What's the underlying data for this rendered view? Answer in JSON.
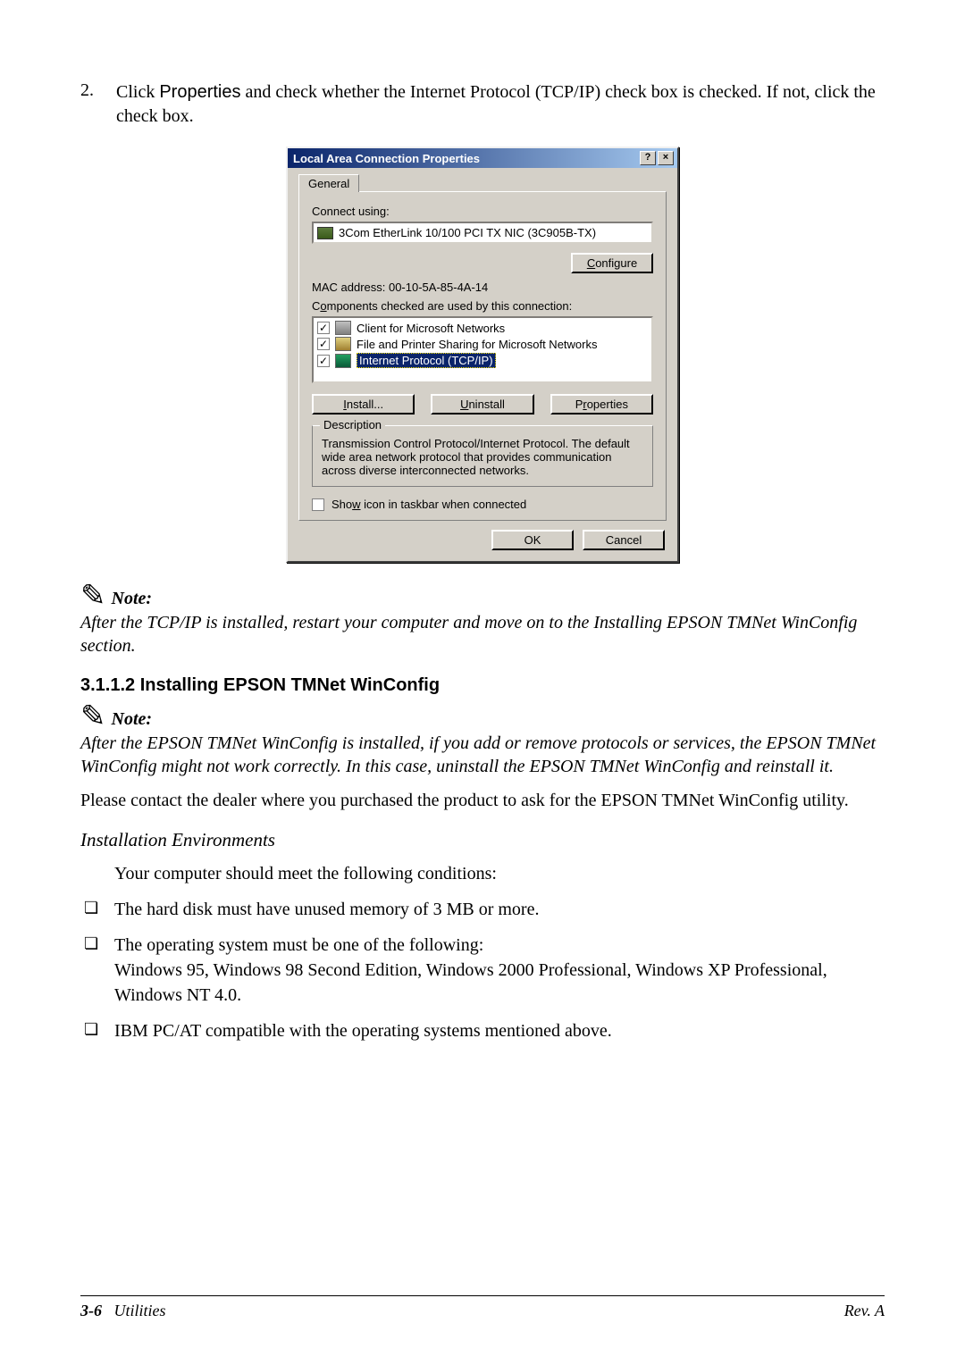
{
  "step": {
    "num": "2.",
    "pre": "Click ",
    "code": "Properties",
    "post": " and check whether the Internet Protocol (TCP/IP) check box is checked. If not, click the check box."
  },
  "dialog": {
    "title": "Local Area Connection Properties",
    "help": "?",
    "close": "×",
    "tab_general": "General",
    "connect_using": "Connect using:",
    "nic": "3Com EtherLink 10/100 PCI TX NIC (3C905B-TX)",
    "configure": "Configure",
    "mac": "MAC address:   00-10-5A-85-4A-14",
    "components_label": "Components checked are used by this connection:",
    "items": [
      {
        "label": "Client for Microsoft Networks"
      },
      {
        "label": "File and Printer Sharing for Microsoft Networks"
      },
      {
        "label": "Internet Protocol (TCP/IP)"
      }
    ],
    "install": "Install...",
    "uninstall": "Uninstall",
    "properties": "Properties",
    "desc_legend": "Description",
    "desc_body": "Transmission Control Protocol/Internet Protocol. The default wide area network protocol that provides communication across diverse interconnected networks.",
    "show_icon": "Show icon in taskbar when connected",
    "ok": "OK",
    "cancel": "Cancel"
  },
  "note1": {
    "label": "Note:",
    "body": "After the TCP/IP is installed, restart your computer and move on to the Installing EPSON TMNet WinConfig section."
  },
  "heading": "3.1.1.2 Installing EPSON TMNet WinConfig",
  "note2": {
    "label": "Note:",
    "body": "After the EPSON TMNet WinConfig is installed, if you add or remove protocols or services, the EPSON TMNet WinConfig might not work correctly. In this case, uninstall the EPSON TMNet WinConfig and reinstall it."
  },
  "para_contact": "Please contact the dealer where you purchased the product to ask for the EPSON TMNet WinConfig utility.",
  "env_heading": "Installation Environments",
  "env_intro": "Your computer should meet the following conditions:",
  "bullets": [
    "The hard disk must have unused memory of 3 MB or more.",
    "The operating system must be one of the following:\nWindows 95, Windows 98 Second Edition, Windows 2000 Professional, Windows XP Professional, Windows NT 4.0.",
    "IBM PC/AT compatible with the operating systems mentioned above."
  ],
  "footer": {
    "page": "3-6",
    "section": "Utilities",
    "rev": "Rev. A"
  }
}
